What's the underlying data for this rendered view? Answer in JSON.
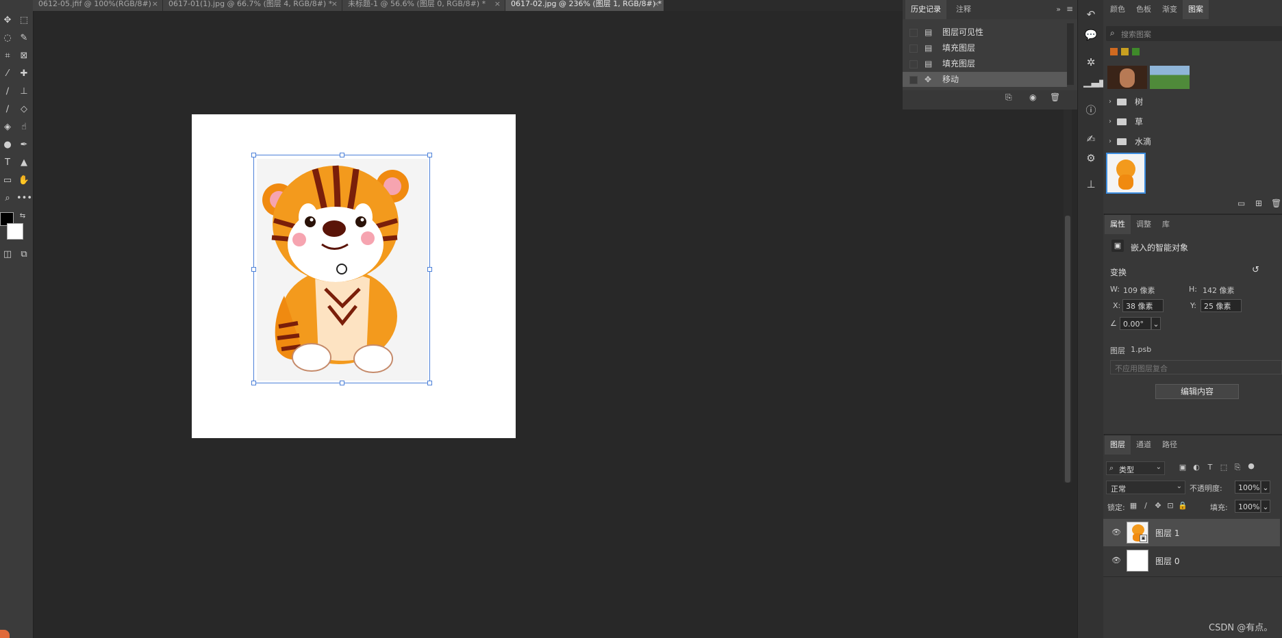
{
  "tabs": [
    {
      "label": "0612-05.jfif @ 100%(RGB/8#)",
      "active": false
    },
    {
      "label": "0617-01(1).jpg @ 66.7% (图层 4, RGB/8#) *",
      "active": false
    },
    {
      "label": "未标题-1 @ 56.6% (图层 0, RGB/8#) *",
      "active": false
    },
    {
      "label": "0617-02.jpg @ 236% (图层 1, RGB/8#) *",
      "active": true
    }
  ],
  "close_glyph": "×",
  "history_panel": {
    "tabs": [
      "历史记录",
      "注释"
    ],
    "items": [
      {
        "label": "图层可见性",
        "icon": "document-icon"
      },
      {
        "label": "填充图层",
        "icon": "document-icon"
      },
      {
        "label": "填充图层",
        "icon": "document-icon"
      },
      {
        "label": "移动",
        "icon": "move-icon",
        "selected": true
      }
    ]
  },
  "patterns_panel": {
    "tabs": [
      "颜色",
      "色板",
      "渐变",
      "图案"
    ],
    "search_placeholder": "搜索图案",
    "groups": [
      "树",
      "草",
      "水滴"
    ]
  },
  "properties_panel": {
    "tabs": [
      "属性",
      "调整",
      "库"
    ],
    "object_type": "嵌入的智能对象",
    "section_transform": "变换",
    "w_label": "W:",
    "w_value": "109 像素",
    "h_label": "H:",
    "h_value": "142 像素",
    "x_label": "X:",
    "x_value": "38 像素",
    "y_label": "Y:",
    "y_value": "25 像素",
    "angle_value": "0.00°",
    "layer_label": "图层",
    "layer_file": "1.psb",
    "comp_placeholder": "不应用图层复合",
    "edit_button": "编辑内容"
  },
  "layers_panel": {
    "tabs": [
      "图层",
      "通道",
      "路径"
    ],
    "filter_label": "类型",
    "blend_mode": "正常",
    "opacity_label": "不透明度:",
    "opacity_value": "100%",
    "lock_label": "锁定:",
    "fill_label": "填充:",
    "fill_value": "100%",
    "layers": [
      {
        "name": "图层 1",
        "selected": true
      },
      {
        "name": "图层 0",
        "selected": false
      }
    ]
  },
  "watermark": "CSDN @有点。",
  "colors": {
    "accent": "#4a7fd8",
    "background": "#282828",
    "panel": "#383838",
    "tiger_orange": "#f39a1d",
    "tiger_stripe": "#7a1f0a"
  }
}
